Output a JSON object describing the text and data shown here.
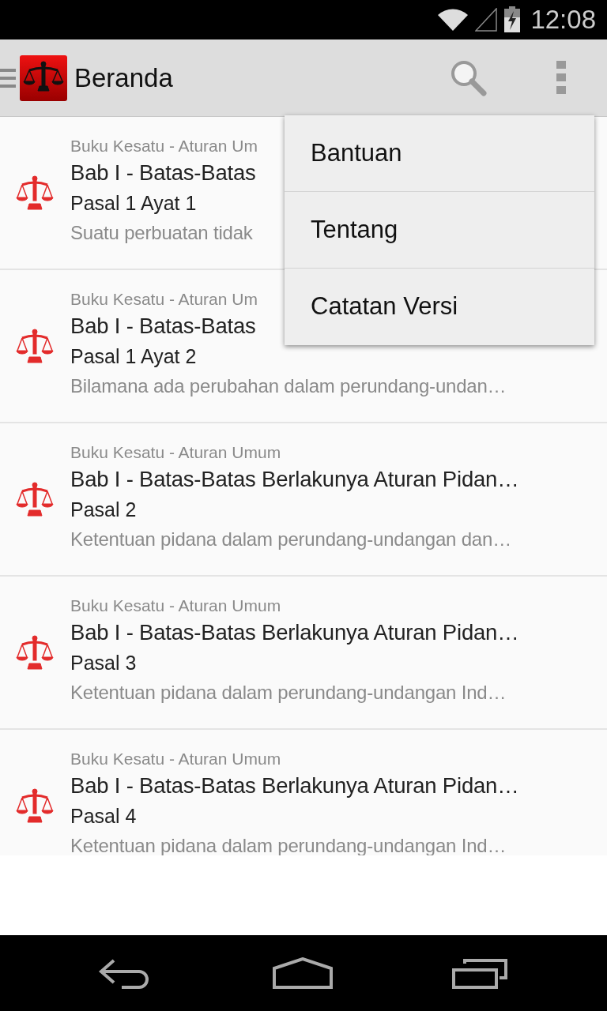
{
  "status_bar": {
    "time": "12:08"
  },
  "action_bar": {
    "title": "Beranda"
  },
  "items": [
    {
      "book": "Buku Kesatu - Aturan Um",
      "chapter": "Bab I - Batas-Batas",
      "article": "Pasal 1 Ayat 1",
      "excerpt": "Suatu perbuatan tidak"
    },
    {
      "book": "Buku Kesatu - Aturan Um",
      "chapter": "Bab I - Batas-Batas",
      "article": "Pasal 1 Ayat 2",
      "excerpt": "Bilamana ada perubahan dalam perundang-undan…"
    },
    {
      "book": "Buku Kesatu - Aturan Umum",
      "chapter": "Bab I - Batas-Batas Berlakunya Aturan Pidan…",
      "article": "Pasal 2",
      "excerpt": "Ketentuan pidana dalam perundang-undangan dan…"
    },
    {
      "book": "Buku Kesatu - Aturan Umum",
      "chapter": "Bab I - Batas-Batas Berlakunya Aturan Pidan…",
      "article": "Pasal 3",
      "excerpt": "Ketentuan pidana dalam perundang-undangan Ind…"
    },
    {
      "book": "Buku Kesatu - Aturan Umum",
      "chapter": "Bab I - Batas-Batas Berlakunya Aturan Pidan…",
      "article": "Pasal 4",
      "excerpt": "Ketentuan pidana dalam perundang-undangan Ind…"
    }
  ],
  "overflow_menu": {
    "items": [
      "Bantuan",
      "Tentang",
      "Catatan Versi"
    ]
  }
}
